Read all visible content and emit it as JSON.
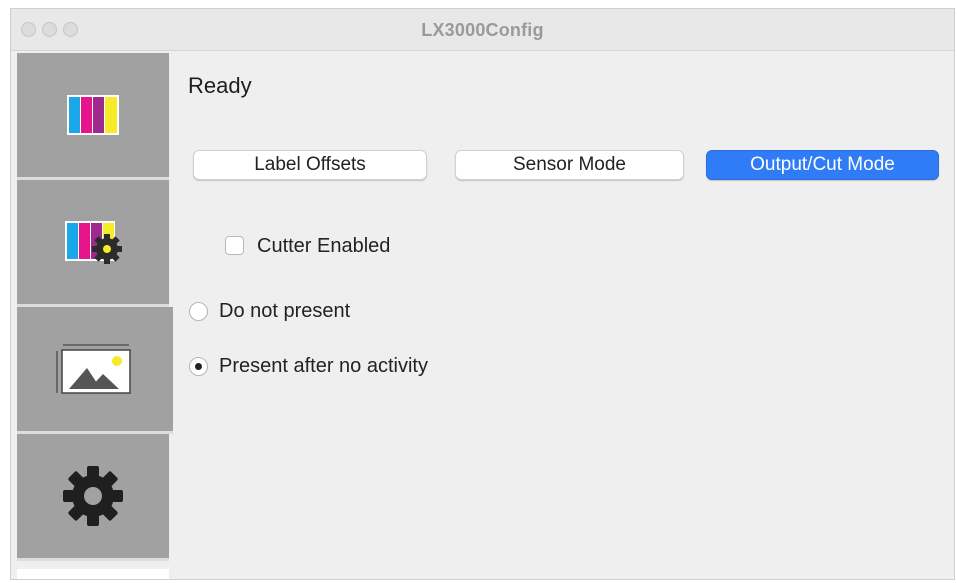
{
  "window": {
    "title": "LX3000Config"
  },
  "sidebar": {
    "items": [
      {
        "icon": "ink-cartridges-icon"
      },
      {
        "icon": "ink-settings-icon"
      },
      {
        "icon": "label-image-icon"
      },
      {
        "icon": "gear-icon"
      }
    ]
  },
  "status": {
    "text": "Ready"
  },
  "tabs": [
    {
      "label": "Label Offsets",
      "selected": false
    },
    {
      "label": "Sensor Mode",
      "selected": false
    },
    {
      "label": "Output/Cut Mode",
      "selected": true
    }
  ],
  "cutter": {
    "label": "Cutter Enabled",
    "checked": false
  },
  "present_options": [
    {
      "label": "Do not present",
      "selected": false
    },
    {
      "label": "Present after no activity",
      "selected": true
    }
  ],
  "colors": {
    "accent": "#2f7cf6",
    "cyan": "#1ba8e8",
    "magenta": "#e5158b",
    "yellow": "#f7ea27"
  }
}
